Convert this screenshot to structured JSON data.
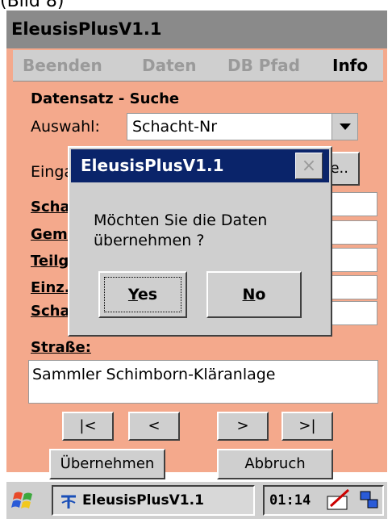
{
  "caption": "(Bild 8)",
  "window": {
    "title": "EleusisPlusV1.1"
  },
  "menu": {
    "items": [
      "Beenden",
      "Daten",
      "DB Pfad",
      "Info"
    ]
  },
  "form": {
    "section_title": "Datensatz - Suche",
    "auswahl_label": "Auswahl:",
    "auswahl_value": "Schacht-Nr",
    "eingabe_label": "Einga",
    "search_button_partial": "e..",
    "field_labels": [
      "Scha",
      "Geme",
      "Teilg",
      "Einz.",
      "Scha"
    ],
    "strasse_label": "Straße:",
    "strasse_value": "Sammler Schimborn-Kläranlage"
  },
  "nav": {
    "first": "|<",
    "prev": "<",
    "next": ">",
    "last": ">|",
    "uebernehmen": "Übernehmen",
    "abbruch": "Abbruch"
  },
  "taskbar": {
    "app_label": "EleusisPlusV1.1",
    "time": "01:14"
  },
  "dialog": {
    "title": "EleusisPlusV1.1",
    "close": "×",
    "message_line1": "Möchten Sie die Daten",
    "message_line2": "übernehmen ?",
    "yes_prefix": "Y",
    "yes_rest": "es",
    "no_prefix": "N",
    "no_rest": "o"
  },
  "colors": {
    "form_background": "#f4a98c",
    "dialog_titlebar": "#0a246a",
    "menubar": "#cfcfcf"
  }
}
